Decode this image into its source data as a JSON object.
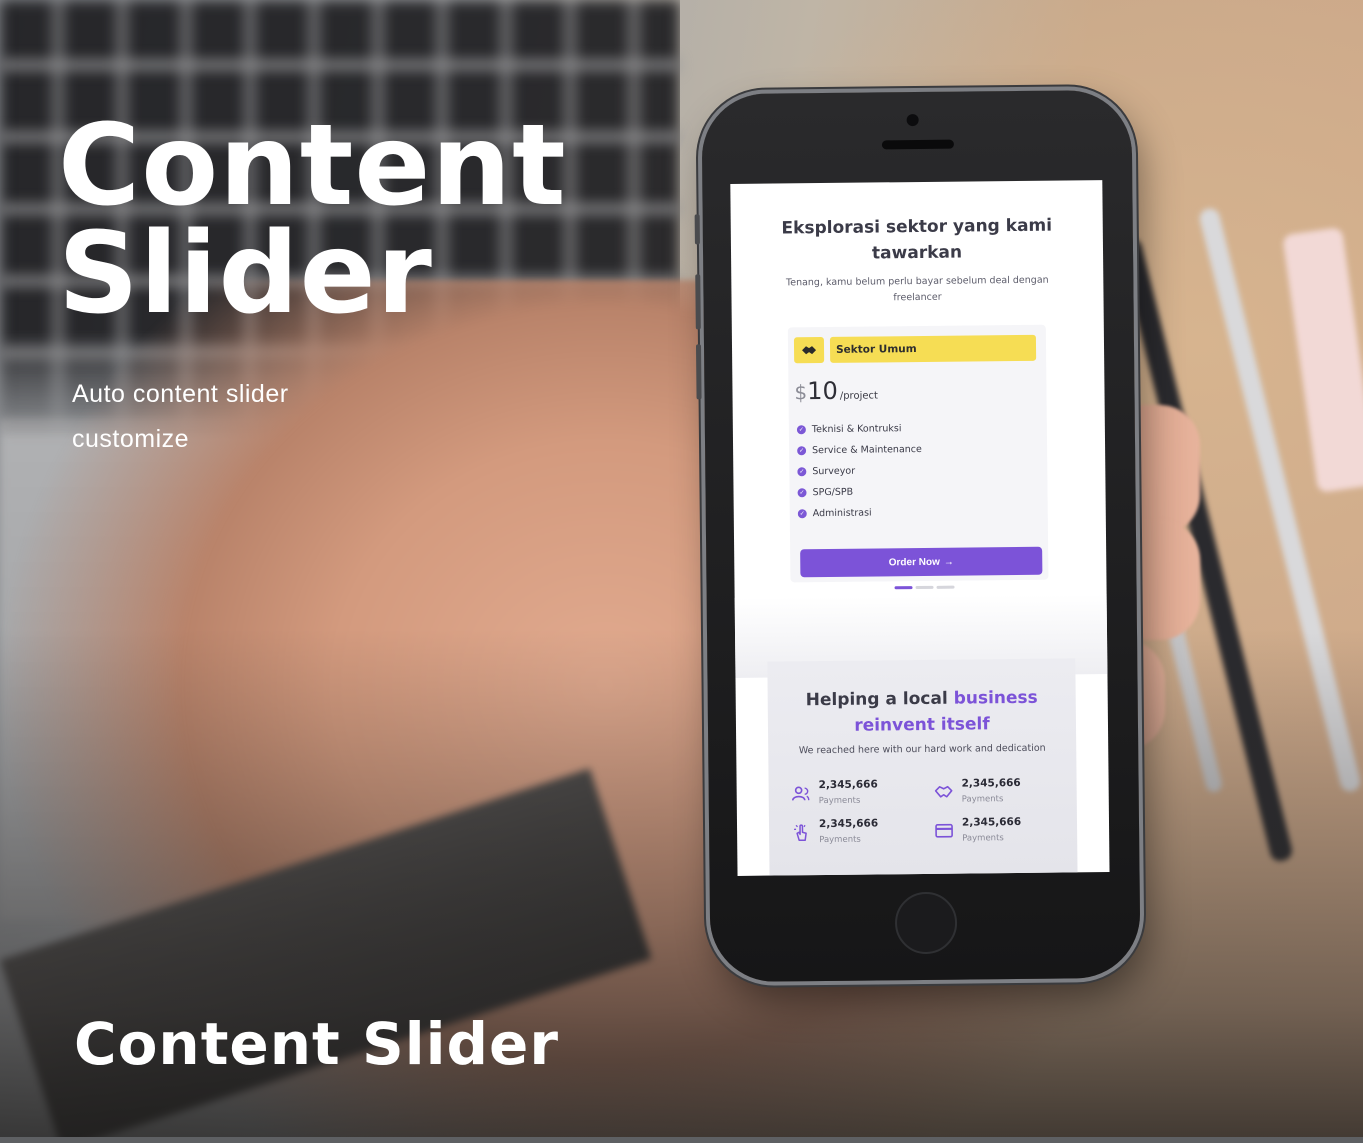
{
  "hero": {
    "title_line1": "Content",
    "title_line2": "Slider",
    "subtitle_line1": "Auto content slider",
    "subtitle_line2": "customize"
  },
  "footer": {
    "title": "Content Slider"
  },
  "phone_screen": {
    "section_title": "Eksplorasi sektor yang kami tawarkan",
    "section_desc": "Tenang, kamu belum perlu bayar sebelum deal dengan freelancer",
    "card": {
      "icon": "handshake-icon",
      "label": "Sektor Umum",
      "currency": "$",
      "price": "10",
      "per": "/project",
      "features": [
        "Teknisi & Kontruksi",
        "Service & Maintenance",
        "Surveyor",
        "SPG/SPB",
        "Administrasi"
      ],
      "button_label": "Order Now",
      "button_icon": "arrow-right-icon"
    },
    "slider": {
      "dot_count": 3,
      "active_index": 0
    },
    "stats": {
      "title_plain": "Helping a local ",
      "title_highlight": "business",
      "title_highlight2": "reinvent itself",
      "desc": "We reached here with our hard work and dedication",
      "items": [
        {
          "icon": "users-icon",
          "value": "2,345,666",
          "label": "Payments"
        },
        {
          "icon": "handshake-icon",
          "value": "2,345,666",
          "label": "Payments"
        },
        {
          "icon": "hand-click-icon",
          "value": "2,345,666",
          "label": "Payments"
        },
        {
          "icon": "credit-card-icon",
          "value": "2,345,666",
          "label": "Payments"
        }
      ]
    }
  },
  "colors": {
    "accent": "#7c53d8",
    "highlight_yellow": "#f6dd54",
    "text_dark": "#3b3b48",
    "hero_text": "#ffffff"
  }
}
